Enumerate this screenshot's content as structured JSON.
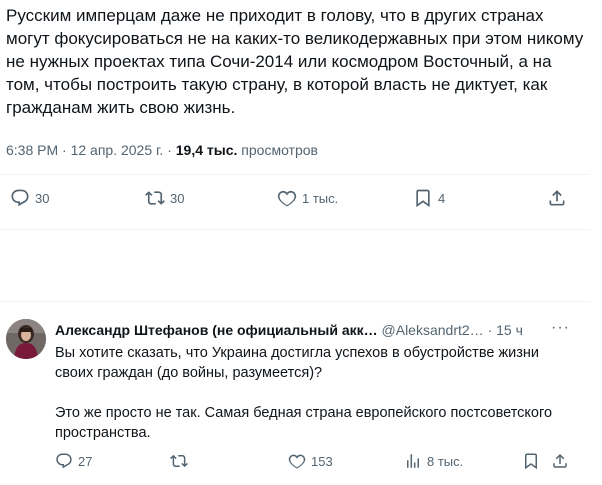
{
  "tweet": {
    "text": "Русским имперцам даже не приходит в голову, что в других странах могут фокусироваться не на каких-то великодержавных при этом никому не нужных проектах типа Сочи-2014 или космодром Восточный, а на том, чтобы построить такую страну, в которой власть не диктует, как гражданам жить свою жизнь.",
    "time": "6:38 PM",
    "date": "12 апр. 2025 г.",
    "views_count": "19,4 тыс.",
    "views_label": "просмотров",
    "separator": "·",
    "actions": {
      "replies": "30",
      "reposts": "30",
      "likes": "1 тыс.",
      "bookmarks": "4"
    }
  },
  "reply": {
    "author": "Александр Штефанов (не официальный акк…",
    "handle": "@Aleksandrt2…",
    "separator": "·",
    "time": "15 ч",
    "more": "···",
    "text": "Вы хотите сказать, что Украина достигла успехов в обустройстве жизни своих граждан (до войны, разумеется)?\n\nЭто же просто не так. Самая бедная страна европейского постсоветского пространства.",
    "actions": {
      "replies": "27",
      "reposts": "",
      "likes": "153",
      "views": "8 тыс."
    }
  },
  "icons": {
    "reply": "comment-bubble-icon",
    "repost": "repost-arrows-icon",
    "like": "heart-icon",
    "bookmark": "bookmark-icon",
    "share": "share-upload-icon",
    "views": "bar-chart-icon",
    "more": "more-dots-icon"
  },
  "colors": {
    "text": "#0f1419",
    "secondary": "#536471",
    "divider": "#eff3f4"
  }
}
